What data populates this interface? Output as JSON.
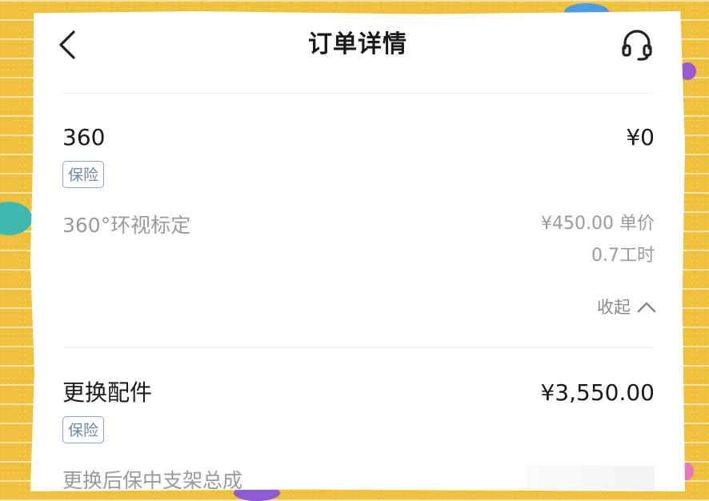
{
  "header": {
    "title": "订单详情",
    "back_icon": "chevron-left-icon",
    "service_icon": "headset-icon"
  },
  "items": [
    {
      "name": "360",
      "price": "¥0",
      "tag": "保险",
      "sub_name": "360°环视标定",
      "unit_price": "¥450.00 单价",
      "hours": "0.7工时",
      "collapse_label": "收起",
      "collapse_icon": "chevron-up-icon"
    },
    {
      "name": "更换配件",
      "price": "¥3,550.00",
      "tag": "保险",
      "sub_name": "更换后保中支架总成"
    }
  ],
  "colors": {
    "tag_border": "#8fa6c3",
    "tag_text": "#6b86a8",
    "secondary_text": "#9a9a9a",
    "primary_text": "#1a1a1a"
  }
}
